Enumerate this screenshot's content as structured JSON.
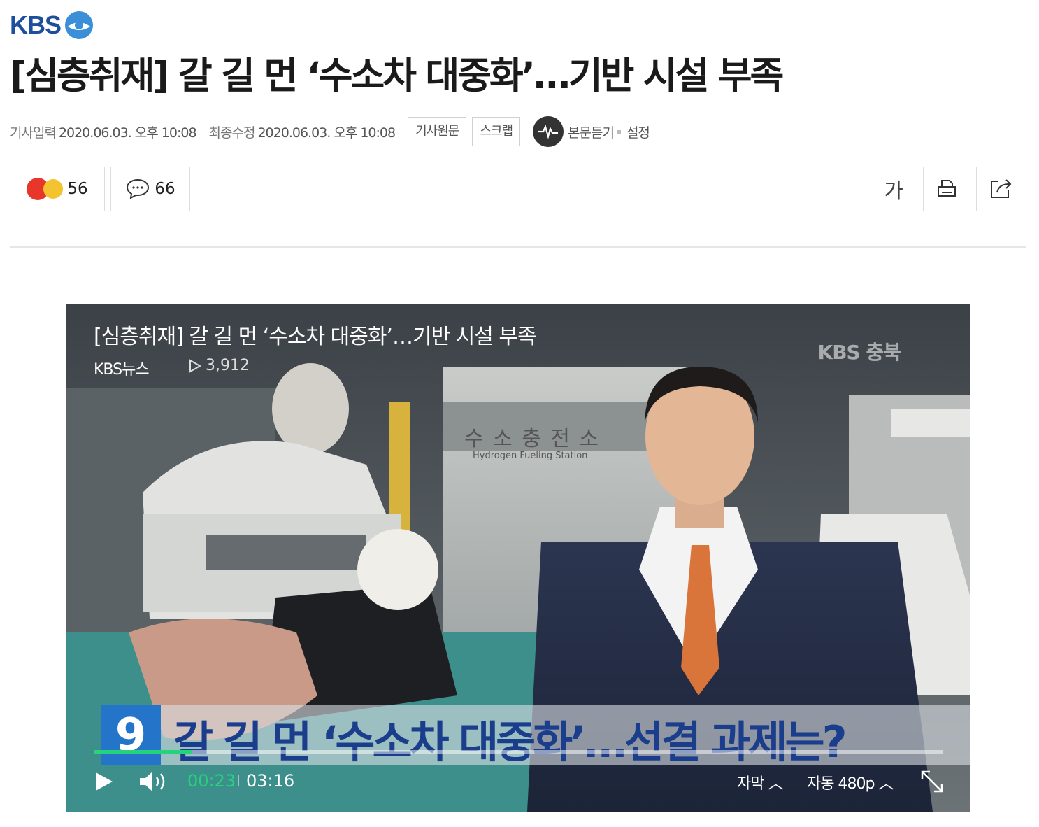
{
  "header": {
    "logo_text": "KBS"
  },
  "article": {
    "headline": "[심층취재] 갈 길 먼 ‘수소차 대중화’…기반 시설 부족",
    "published_label": "기사입력",
    "published_value": "2020.06.03. 오후 10:08",
    "modified_label": "최종수정",
    "modified_value": "2020.06.03. 오후 10:08",
    "original_button": "기사원문",
    "scrap_button": "스크랩",
    "tts_label": "본문듣기",
    "tts_settings": "설정"
  },
  "reactions": {
    "emoji_count": "56",
    "comment_count": "66"
  },
  "tools": {
    "font_label": "가"
  },
  "video": {
    "title": "[심층취재] 갈 길 먼 ‘수소차 대중화’…기반 시설 부족",
    "channel": "KBS뉴스",
    "views": "3,912",
    "watermark": "KBS 충북",
    "station_sign": "수 소 충 전 소",
    "station_sign_en": "Hydrogen Fueling Station",
    "caption_number": "9",
    "caption_text": "갈 길 먼 ‘수소차 대중화’…선결 과제는?",
    "current_time": "00:23",
    "duration": "03:16",
    "progress": 0.115,
    "subtitle_label": "자막 ︿",
    "quality_label": "자동 480p ︿"
  },
  "colors": {
    "brand": "#1d4f9c",
    "progress": "#26d27b"
  },
  "icons": [
    "kbs-logo-icon",
    "angry-emoji-icon",
    "sad-emoji-icon",
    "comment-icon",
    "tts-icon",
    "print-icon",
    "share-icon",
    "play-icon",
    "volume-icon",
    "fullscreen-icon",
    "play-triangle-icon"
  ]
}
